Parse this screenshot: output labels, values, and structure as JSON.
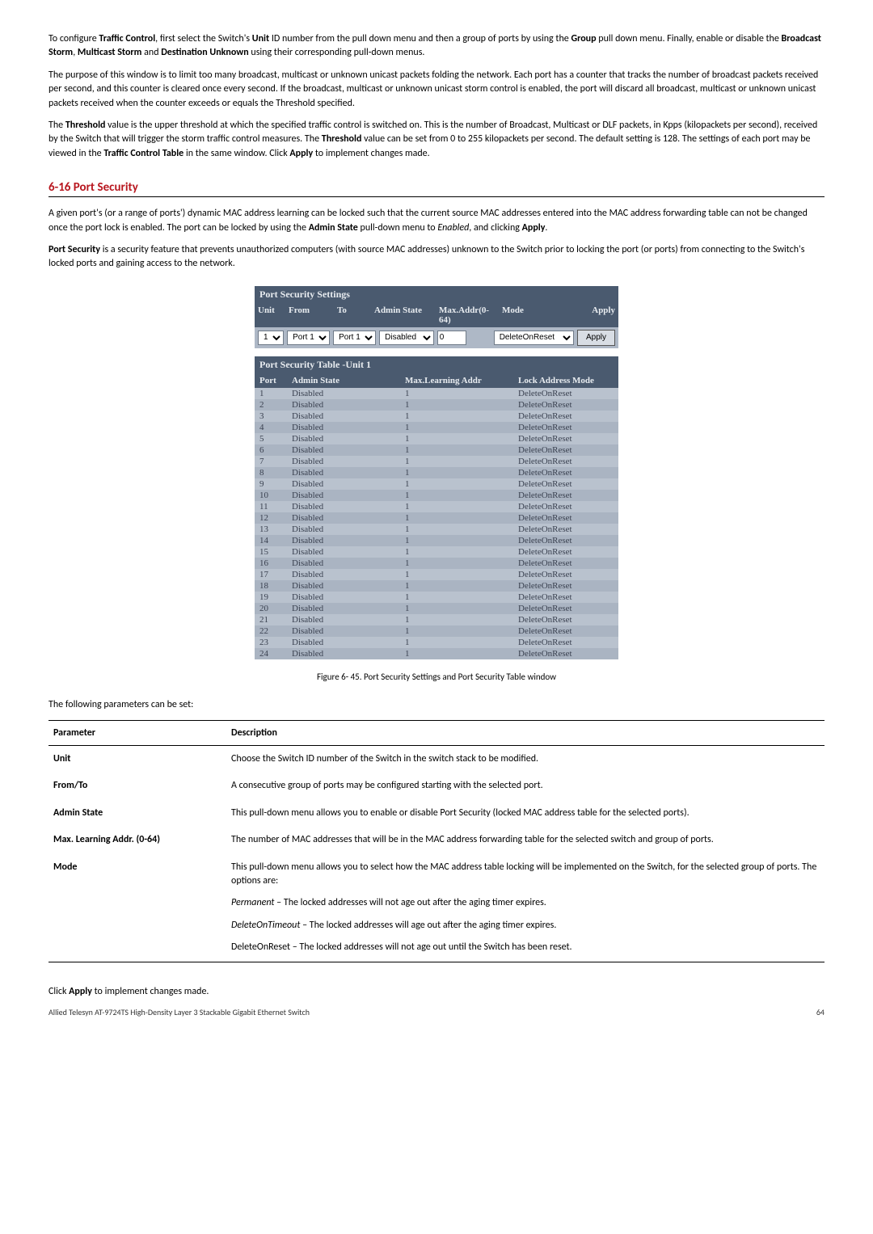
{
  "intro": {
    "p1a": "To configure ",
    "p1b": "Traffic Control",
    "p1c": ", first select the Switch's ",
    "p1d": "Unit",
    "p1e": " ID number from the pull down menu and then a group of ports by using the ",
    "p1f": "Group",
    "p1g": " pull down menu. Finally, enable or disable the ",
    "p1h": "Broadcast Storm",
    "p1i": ", ",
    "p1j": "Multicast Storm",
    "p1k": " and ",
    "p1l": "Destination Unknown",
    "p1m": " using their corresponding pull-down menus.",
    "p2": "The purpose of this window is to limit too many broadcast, multicast or unknown unicast packets folding the network. Each port has a counter that tracks the number of broadcast packets received per second, and this counter is cleared once every second. If the broadcast, multicast or unknown unicast storm control is enabled, the port will discard all broadcast, multicast or unknown unicast packets received when the counter exceeds or equals the Threshold specified.",
    "p3a": "The ",
    "p3b": "Threshold",
    "p3c": " value is the upper threshold at which the specified traffic control is switched on. This is the number of Broadcast, Multicast or DLF packets, in Kpps (kilopackets per second), received by the Switch that will trigger the storm traffic control measures. The ",
    "p3d": "Threshold",
    "p3e": " value can be set from 0 to 255 kilopackets per second. The default setting is 128. The settings of each port may be viewed in the ",
    "p3f": "Traffic Control Table",
    "p3g": " in the same window. Click ",
    "p3h": "Apply",
    "p3i": " to implement changes made."
  },
  "section_title": "6-16 Port Security",
  "sec": {
    "p1a": "A given port's (or a range of ports') dynamic MAC address learning can be locked such that the current source MAC addresses entered into the MAC address forwarding table can not be changed once the port lock is enabled. The port can be locked by using the ",
    "p1b": "Admin State",
    "p1c": " pull-down menu to ",
    "p1d": "Enabled",
    "p1e": ", and clicking ",
    "p1f": "Apply",
    "p1g": ".",
    "p2a": "Port Security",
    "p2b": " is a security feature that prevents unauthorized computers (with source MAC addresses) unknown to the Switch prior to locking the port (or ports) from connecting to the Switch's locked ports and gaining access to the network."
  },
  "shot": {
    "settings_title": "Port Security Settings",
    "col_unit": "Unit",
    "col_from": "From",
    "col_to": "To",
    "col_admin": "Admin State",
    "col_max": "Max.Addr(0-64)",
    "col_mode": "Mode",
    "col_apply": "Apply",
    "sel_unit": "1",
    "sel_from": "Port 1",
    "sel_to": "Port 1",
    "sel_admin": "Disabled",
    "inp_max": "0",
    "sel_mode": "DeleteOnReset",
    "btn_apply": "Apply",
    "table_title": "Port Security Table -Unit 1",
    "th_port": "Port",
    "th_admin": "Admin State",
    "th_mla": "Max.Learning Addr",
    "th_lam": "Lock Address Mode",
    "rows": [
      {
        "port": "1",
        "admin": "Disabled",
        "mla": "1",
        "mode": "DeleteOnReset"
      },
      {
        "port": "2",
        "admin": "Disabled",
        "mla": "1",
        "mode": "DeleteOnReset"
      },
      {
        "port": "3",
        "admin": "Disabled",
        "mla": "1",
        "mode": "DeleteOnReset"
      },
      {
        "port": "4",
        "admin": "Disabled",
        "mla": "1",
        "mode": "DeleteOnReset"
      },
      {
        "port": "5",
        "admin": "Disabled",
        "mla": "1",
        "mode": "DeleteOnReset"
      },
      {
        "port": "6",
        "admin": "Disabled",
        "mla": "1",
        "mode": "DeleteOnReset"
      },
      {
        "port": "7",
        "admin": "Disabled",
        "mla": "1",
        "mode": "DeleteOnReset"
      },
      {
        "port": "8",
        "admin": "Disabled",
        "mla": "1",
        "mode": "DeleteOnReset"
      },
      {
        "port": "9",
        "admin": "Disabled",
        "mla": "1",
        "mode": "DeleteOnReset"
      },
      {
        "port": "10",
        "admin": "Disabled",
        "mla": "1",
        "mode": "DeleteOnReset"
      },
      {
        "port": "11",
        "admin": "Disabled",
        "mla": "1",
        "mode": "DeleteOnReset"
      },
      {
        "port": "12",
        "admin": "Disabled",
        "mla": "1",
        "mode": "DeleteOnReset"
      },
      {
        "port": "13",
        "admin": "Disabled",
        "mla": "1",
        "mode": "DeleteOnReset"
      },
      {
        "port": "14",
        "admin": "Disabled",
        "mla": "1",
        "mode": "DeleteOnReset"
      },
      {
        "port": "15",
        "admin": "Disabled",
        "mla": "1",
        "mode": "DeleteOnReset"
      },
      {
        "port": "16",
        "admin": "Disabled",
        "mla": "1",
        "mode": "DeleteOnReset"
      },
      {
        "port": "17",
        "admin": "Disabled",
        "mla": "1",
        "mode": "DeleteOnReset"
      },
      {
        "port": "18",
        "admin": "Disabled",
        "mla": "1",
        "mode": "DeleteOnReset"
      },
      {
        "port": "19",
        "admin": "Disabled",
        "mla": "1",
        "mode": "DeleteOnReset"
      },
      {
        "port": "20",
        "admin": "Disabled",
        "mla": "1",
        "mode": "DeleteOnReset"
      },
      {
        "port": "21",
        "admin": "Disabled",
        "mla": "1",
        "mode": "DeleteOnReset"
      },
      {
        "port": "22",
        "admin": "Disabled",
        "mla": "1",
        "mode": "DeleteOnReset"
      },
      {
        "port": "23",
        "admin": "Disabled",
        "mla": "1",
        "mode": "DeleteOnReset"
      },
      {
        "port": "24",
        "admin": "Disabled",
        "mla": "1",
        "mode": "DeleteOnReset"
      }
    ]
  },
  "figcap": "Figure 6- 45. Port Security Settings and Port Security Table window",
  "paramintro": "The following parameters can be set:",
  "ptable": {
    "h_param": "Parameter",
    "h_desc": "Description",
    "rows": [
      {
        "name": "Unit",
        "desc": "Choose the Switch ID number of the Switch in the switch stack to be modified."
      },
      {
        "name": "From/To",
        "desc": "A consecutive group of ports may be configured starting with the selected port."
      },
      {
        "name": "Admin State",
        "desc": "This pull-down menu allows you to enable or disable Port Security (locked MAC address table for the selected ports)."
      },
      {
        "name": "Max. Learning Addr. (0-64)",
        "desc": "The number of MAC addresses that will be in the MAC address forwarding table for the selected switch and group of ports."
      }
    ],
    "mode_name": "Mode",
    "mode_d1": "This pull-down menu allows you to select how the MAC address table locking will be implemented on the Switch, for the selected group of ports. The options are:",
    "mode_perm_i": "Permanent",
    "mode_perm_t": " – The locked addresses will not age out after the aging timer expires.",
    "mode_dot_i": "DeleteOnTimeout",
    "mode_dot_t": " – The locked addresses will age out after the aging timer expires.",
    "mode_dor": "DeleteOnReset – The locked addresses will not age out until the Switch has been reset."
  },
  "closing_a": "Click ",
  "closing_b": "Apply",
  "closing_c": " to implement changes made.",
  "footer_src": "Allied Telesyn AT-9724TS High-Density Layer 3 Stackable Gigabit Ethernet Switch",
  "footer_pg": "64"
}
